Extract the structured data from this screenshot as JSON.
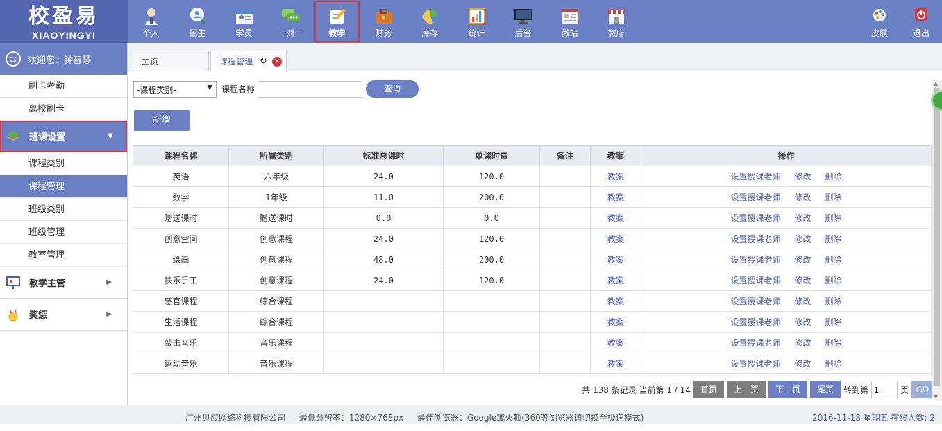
{
  "logo": {
    "title": "校盈易",
    "subtitle": "XIAOYINGYI"
  },
  "nav": [
    {
      "label": "个人",
      "icon": "person-icon"
    },
    {
      "label": "招生",
      "icon": "magnifier-person-icon"
    },
    {
      "label": "学员",
      "icon": "student-card-icon"
    },
    {
      "label": "一对一",
      "icon": "chat-bubbles-icon"
    },
    {
      "label": "教学",
      "icon": "pencil-note-icon",
      "active": true
    },
    {
      "label": "财务",
      "icon": "briefcase-icon"
    },
    {
      "label": "库存",
      "icon": "pie-icon"
    },
    {
      "label": "统计",
      "icon": "bar-chart-icon"
    },
    {
      "label": "后台",
      "icon": "monitor-icon"
    },
    {
      "label": "微站",
      "icon": "webpage-icon"
    },
    {
      "label": "微店",
      "icon": "shop-icon"
    }
  ],
  "nav_right": [
    {
      "label": "皮肤",
      "icon": "palette-icon"
    },
    {
      "label": "退出",
      "icon": "power-icon"
    }
  ],
  "sidebar": {
    "welcome": "欢迎您：钟智慧",
    "top_items": [
      "刷卡考勤",
      "离校刷卡"
    ],
    "group_open": "班课设置",
    "sub_items": [
      "课程类别",
      "课程管理",
      "班级类别",
      "班级管理",
      "教室管理"
    ],
    "active_sub": "课程管理",
    "groups": [
      "教学主管",
      "奖惩"
    ]
  },
  "tabs": {
    "home": "主页",
    "current": "课程管理"
  },
  "filter": {
    "category_select": "-课程类别-",
    "name_label": "课程名称",
    "name_value": "",
    "query_label": "查询",
    "add_label": "新增"
  },
  "table": {
    "headers": [
      "课程名称",
      "所属类别",
      "标准总课时",
      "单课时费",
      "备注",
      "教案",
      "操作"
    ],
    "rows": [
      {
        "name": "英语",
        "category": "六年级",
        "hours": "24.0",
        "fee": "120.0",
        "note": ""
      },
      {
        "name": "数学",
        "category": "1年级",
        "hours": "11.0",
        "fee": "200.0",
        "note": ""
      },
      {
        "name": "赠送课时",
        "category": "赠送课时",
        "hours": "0.0",
        "fee": "0.0",
        "note": ""
      },
      {
        "name": "创意空间",
        "category": "创意课程",
        "hours": "24.0",
        "fee": "120.0",
        "note": ""
      },
      {
        "name": "绘画",
        "category": "创意课程",
        "hours": "48.0",
        "fee": "200.0",
        "note": ""
      },
      {
        "name": "快乐手工",
        "category": "创意课程",
        "hours": "24.0",
        "fee": "120.0",
        "note": ""
      },
      {
        "name": "感官课程",
        "category": "综合课程",
        "hours": "",
        "fee": "",
        "note": ""
      },
      {
        "name": "生活课程",
        "category": "综合课程",
        "hours": "",
        "fee": "",
        "note": ""
      },
      {
        "name": "敲击音乐",
        "category": "音乐课程",
        "hours": "",
        "fee": "",
        "note": ""
      },
      {
        "name": "运动音乐",
        "category": "音乐课程",
        "hours": "",
        "fee": "",
        "note": ""
      }
    ],
    "plan_link": "教案",
    "ops": [
      "设置授课老师",
      "修改",
      "删除"
    ]
  },
  "pager": {
    "summary": "共 138 条记录 当前第 1 / 14",
    "first": "首页",
    "prev": "上一页",
    "next": "下一页",
    "last": "尾页",
    "goto_label": "转到第",
    "goto_value": "1",
    "page_unit": "页",
    "go": "GO"
  },
  "footer": {
    "company": "广州贝应网络科技有限公司",
    "resolution": "最低分辨率：1280×768px",
    "browser": "最佳浏览器：Google或火狐(360等浏览器请切换至极速模式)",
    "status": "2016-11-18 星期五 在线人数: 2"
  },
  "colors": {
    "primary": "#6b7fc4",
    "highlight_border": "#d9353b",
    "link": "#4a5fa8"
  }
}
